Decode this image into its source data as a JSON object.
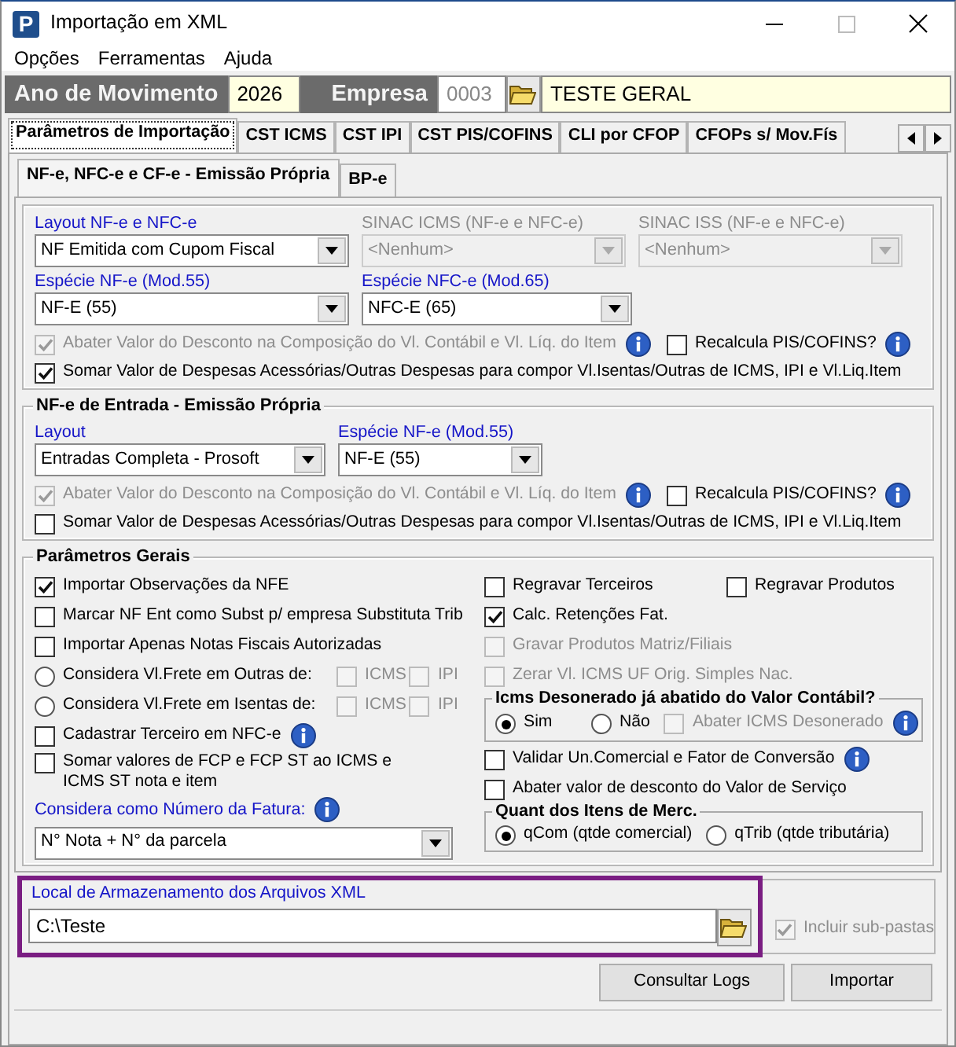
{
  "window": {
    "app_icon_letter": "P",
    "title": "Importação em XML"
  },
  "menu": [
    "Opções",
    "Ferramentas",
    "Ajuda"
  ],
  "header": {
    "year_label": "Ano de Movimento",
    "year": "2026",
    "company_label": "Empresa",
    "company_code": "0003",
    "company_name": "TESTE GERAL"
  },
  "tabs": [
    {
      "label": "Parâmetros de Importação",
      "selected": true
    },
    {
      "label": "CST ICMS",
      "selected": false
    },
    {
      "label": "CST IPI",
      "selected": false
    },
    {
      "label": "CST PIS/COFINS",
      "selected": false
    },
    {
      "label": "CLI por CFOP",
      "selected": false
    },
    {
      "label": "CFOPs s/ Mov.Fís",
      "selected": false
    }
  ],
  "subtabs": [
    {
      "label": "NF-e, NFC-e e CF-e - Emissão Própria",
      "selected": true
    },
    {
      "label": "BP-e",
      "selected": false
    }
  ],
  "emissao_propria": {
    "selects": [
      {
        "kind": "select",
        "label": "Layout NF-e e NFC-e",
        "value": "NF Emitida com Cupom Fiscal",
        "disabled": false
      },
      {
        "kind": "select",
        "label": "SINAC ICMS (NF-e e NFC-e)",
        "value": "<Nenhum>",
        "disabled": true
      },
      {
        "kind": "select",
        "label": "SINAC ISS (NF-e e NFC-e)",
        "value": "<Nenhum>",
        "disabled": true
      },
      {
        "kind": "select",
        "label": "Espécie NF-e (Mod.55)",
        "value": "NF-E (55)",
        "disabled": false
      },
      {
        "kind": "select",
        "label": "Espécie NFC-e (Mod.65)",
        "value": "NFC-E (65)",
        "disabled": false
      }
    ],
    "options": [
      {
        "kind": "checkbox",
        "label": "Abater Valor do Desconto na Composição do Vl. Contábil e Vl. Líq. do Item",
        "checked": true,
        "disabled": true,
        "info": true
      },
      {
        "kind": "checkbox",
        "label": "Recalcula PIS/COFINS?",
        "checked": false,
        "disabled": false,
        "info": true
      },
      {
        "kind": "checkbox",
        "label": "Somar Valor de Despesas Acessórias/Outras Despesas para compor Vl.Isentas/Outras de ICMS, IPI e Vl.Liq.Item",
        "checked": true,
        "disabled": false
      }
    ]
  },
  "entrada": {
    "legend": "NF-e de Entrada - Emissão Própria",
    "selects": [
      {
        "kind": "select",
        "label": "Layout",
        "value": "Entradas Completa - Prosoft",
        "disabled": false
      },
      {
        "kind": "select",
        "label": "Espécie NF-e (Mod.55)",
        "value": "NF-E (55)",
        "disabled": false
      }
    ],
    "options": [
      {
        "kind": "checkbox",
        "label": "Abater Valor do Desconto na Composição do Vl. Contábil e Vl. Líq. do Item",
        "checked": true,
        "disabled": true,
        "info": true
      },
      {
        "kind": "checkbox",
        "label": "Recalcula PIS/COFINS?",
        "checked": false,
        "disabled": false,
        "info": true
      },
      {
        "kind": "checkbox",
        "label": "Somar Valor de Despesas Acessórias/Outras Despesas para compor Vl.Isentas/Outras de ICMS, IPI e Vl.Liq.Item",
        "checked": false,
        "disabled": false
      }
    ]
  },
  "gerais": {
    "legend": "Parâmetros Gerais",
    "columns": [
      {
        "rows": [
          [
            {
              "kind": "checkbox",
              "label": "Importar Observações da NFE",
              "checked": true,
              "disabled": false
            }
          ],
          [
            {
              "kind": "checkbox",
              "label": "Marcar NF Ent como Subst p/ empresa Substituta Trib",
              "checked": false,
              "disabled": false
            }
          ],
          [
            {
              "kind": "checkbox",
              "label": "Importar Apenas Notas Fiscais Autorizadas",
              "checked": false,
              "disabled": false
            }
          ],
          [
            {
              "kind": "radio",
              "label": "Considera Vl.Frete em Outras de:",
              "selected": false
            },
            {
              "kind": "checkbox",
              "label": "ICMS",
              "checked": false,
              "disabled": true
            },
            {
              "kind": "checkbox",
              "label": "IPI",
              "checked": false,
              "disabled": true
            }
          ],
          [
            {
              "kind": "radio",
              "label": "Considera Vl.Frete em Isentas de:",
              "selected": false
            },
            {
              "kind": "checkbox",
              "label": "ICMS",
              "checked": false,
              "disabled": true
            },
            {
              "kind": "checkbox",
              "label": "IPI",
              "checked": false,
              "disabled": true
            }
          ],
          [
            {
              "kind": "checkbox",
              "label": "Cadastrar Terceiro em NFC-e",
              "checked": false,
              "disabled": false,
              "info": true
            }
          ],
          [
            {
              "kind": "checkbox",
              "label": "Somar valores de FCP e FCP ST ao ICMS e ICMS ST nota e item",
              "checked": false,
              "disabled": false
            }
          ],
          [
            {
              "kind": "label",
              "label": "Considera como Número da Fatura:",
              "info": true
            }
          ],
          [
            {
              "kind": "select",
              "value": "N° Nota + N° da parcela",
              "disabled": false
            }
          ]
        ]
      },
      {
        "rows": [
          [
            {
              "kind": "checkbox",
              "label": "Regravar Terceiros",
              "checked": false,
              "disabled": false
            },
            {
              "kind": "checkbox",
              "label": "Regravar Produtos",
              "checked": false,
              "disabled": false
            }
          ],
          [
            {
              "kind": "checkbox",
              "label": "Calc. Retenções Fat.",
              "checked": true,
              "disabled": false
            }
          ],
          [
            {
              "kind": "checkbox",
              "label": "Gravar Produtos Matriz/Filiais",
              "checked": false,
              "disabled": true
            }
          ],
          [
            {
              "kind": "checkbox",
              "label": "Zerar Vl. ICMS UF Orig. Simples Nac.",
              "checked": false,
              "disabled": true
            }
          ],
          [
            {
              "kind": "group",
              "legend": "Icms Desonerado já abatido do Valor Contábil?",
              "items": [
                {
                  "kind": "radio",
                  "label": "Sim",
                  "selected": true
                },
                {
                  "kind": "radio",
                  "label": "Não",
                  "selected": false
                },
                {
                  "kind": "checkbox",
                  "label": "Abater ICMS Desonerado",
                  "checked": false,
                  "disabled": true,
                  "info": true
                }
              ]
            }
          ],
          [
            {
              "kind": "checkbox",
              "label": "Validar Un.Comercial e Fator de Conversão",
              "checked": false,
              "disabled": false,
              "info": true
            }
          ],
          [
            {
              "kind": "checkbox",
              "label": "Abater valor de desconto do Valor de Serviço",
              "checked": false,
              "disabled": false
            }
          ],
          [
            {
              "kind": "group",
              "legend": "Quant dos Itens de Merc.",
              "items": [
                {
                  "kind": "radio",
                  "label": "qCom (qtde comercial)",
                  "selected": true
                },
                {
                  "kind": "radio",
                  "label": "qTrib (qtde tributária)",
                  "selected": false
                }
              ]
            }
          ]
        ]
      }
    ]
  },
  "storage": {
    "legend": "Local de Armazenamento dos Arquivos XML",
    "path": "C:\\Teste",
    "highlighted": true,
    "include_subfolders": {
      "label": "Incluir sub-pastas",
      "checked": true,
      "disabled": true
    }
  },
  "buttons": [
    "Consultar Logs",
    "Importar"
  ]
}
